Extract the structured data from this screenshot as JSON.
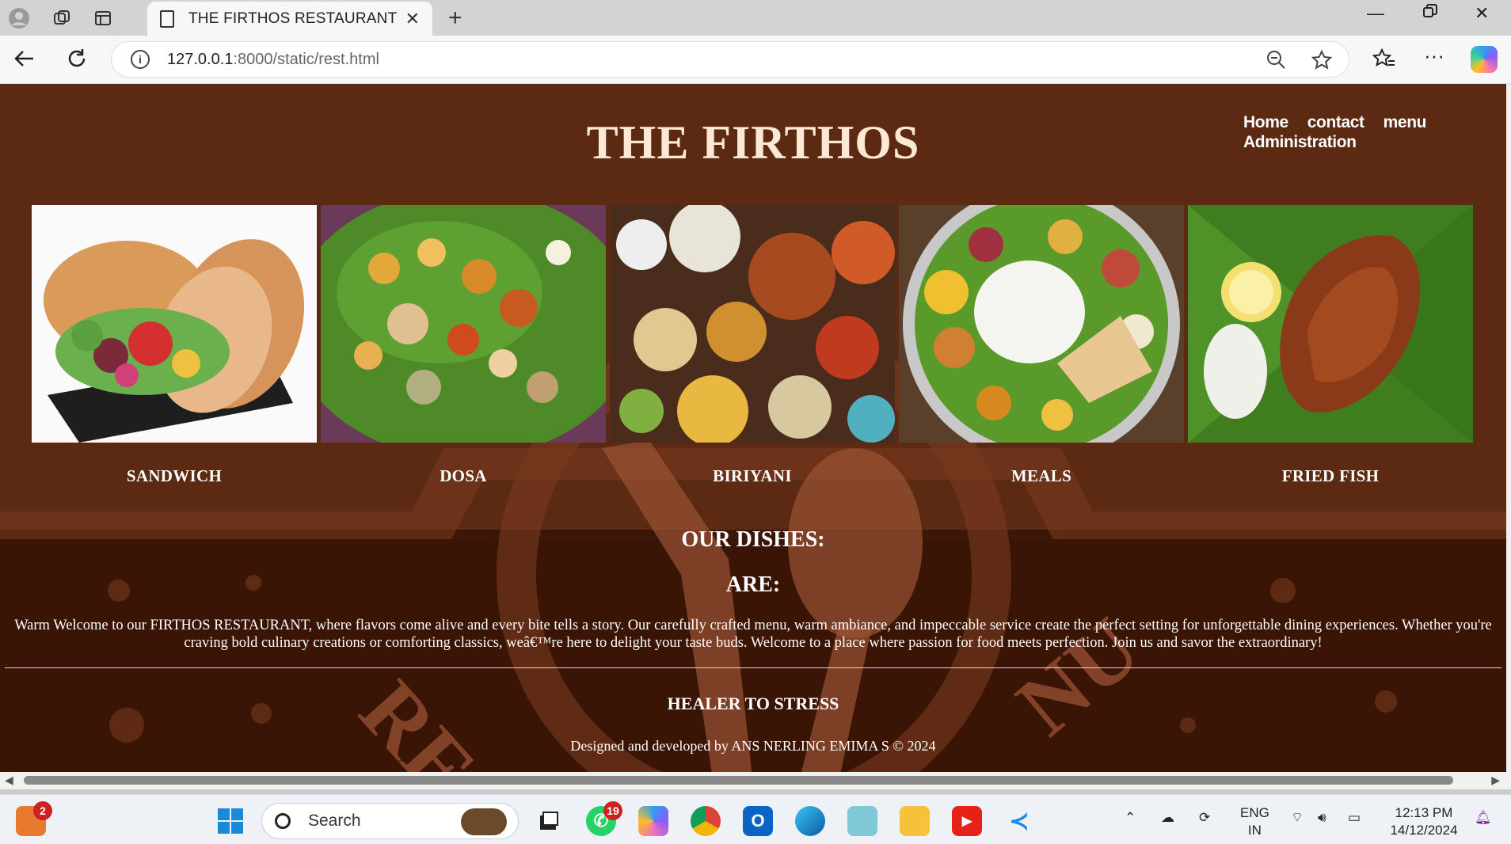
{
  "browser": {
    "tab_title": "THE FIRTHOS RESTAURANT",
    "url_host": "127.0.0.1",
    "url_path": ":8000/static/rest.html"
  },
  "site": {
    "brand": "THE FIRTHOS",
    "nav": [
      "Home",
      "contact",
      "menu",
      "Administration"
    ],
    "dishes": [
      {
        "name": "SANDWICH",
        "icon": "sandwich-photo"
      },
      {
        "name": "DOSA",
        "icon": "dosa-photo"
      },
      {
        "name": "BIRIYANI",
        "icon": "biriyani-photo"
      },
      {
        "name": "MEALS",
        "icon": "meals-photo"
      },
      {
        "name": "FRIED FISH",
        "icon": "fried-fish-photo"
      }
    ],
    "heading_dishes": "OUR DISHES:",
    "heading_are": "ARE:",
    "welcome_text": "Warm Welcome to our FIRTHOS RESTAURANT, where flavors come alive and every bite tells a story. Our carefully crafted menu, warm ambiance, and impeccable service create the perfect setting for unforgettable dining experiences. Whether you're craving bold culinary creations or comforting classics, weâ€™re here to delight your taste buds. Welcome to a place where passion for food meets perfection. Join us and savor the extraordinary!",
    "tagline": "HEALER TO STRESS",
    "credit": "Designed and developed by ANS NERLING EMIMA S © 2024"
  },
  "taskbar": {
    "search_label": "Search",
    "badge_left": "2",
    "badge_whatsapp": "19",
    "lang_line1": "ENG",
    "lang_line2": "IN",
    "time": "12:13 PM",
    "date": "14/12/2024"
  },
  "colors": {
    "page_brown": "#5c2a12",
    "page_dark": "#3a1505",
    "brand_text": "#fde8d6"
  }
}
